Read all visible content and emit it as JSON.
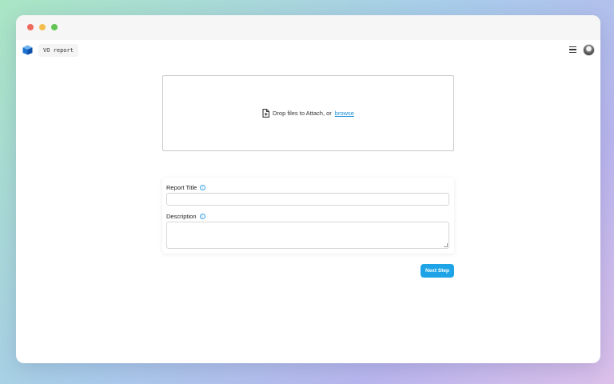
{
  "app": {
    "name": "VO report",
    "brand_color": "#1ea4e6"
  },
  "window_controls": [
    "close",
    "minimize",
    "zoom"
  ],
  "navbar": {
    "menu_icon": "hamburger-menu-icon",
    "avatar_icon": "user-avatar"
  },
  "dropzone": {
    "icon": "file-add-icon",
    "text": "Drop files to Attach, or",
    "link": "browse"
  },
  "form": {
    "title_label": "Report Title",
    "title_value": "",
    "description_label": "Description",
    "description_value": "",
    "info_icon": "info-icon"
  },
  "actions": {
    "next_label": "Next Step"
  }
}
